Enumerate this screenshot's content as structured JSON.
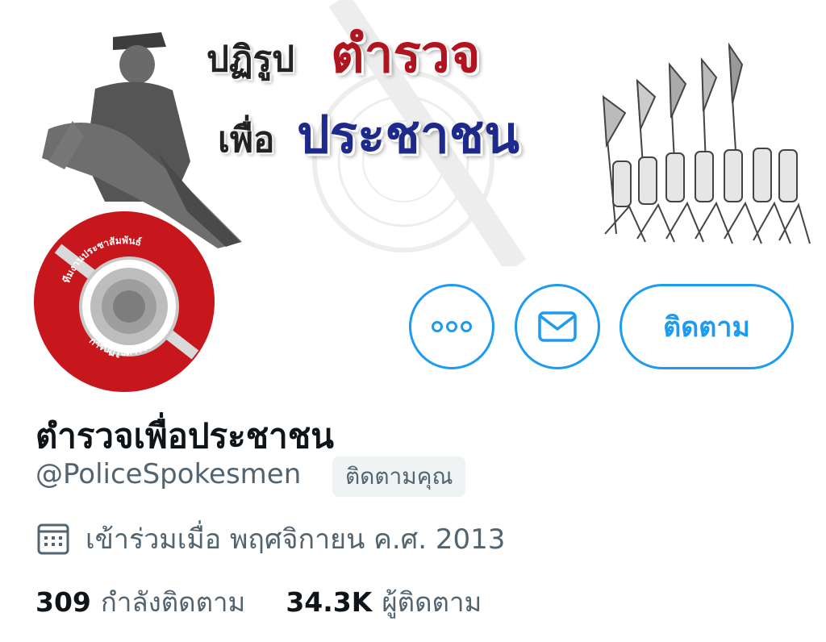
{
  "banner": {
    "line1_prefix": "ปฏิรูป",
    "line1_highlight": "ตำรวจ",
    "line2_prefix": "เพื่อ",
    "line2_highlight": "ประชาชน"
  },
  "avatar": {
    "ring_text_top": "ทีมงานประชาสัมพันธ์",
    "ring_text_bottom": "การปฏิรูปตำรวจ"
  },
  "actions": {
    "more_icon": "more-horizontal-icon",
    "message_icon": "envelope-icon",
    "follow_label": "ติดตาม"
  },
  "profile": {
    "display_name": "ตำรวจเพื่อประชาชน",
    "handle": "@PoliceSpokesmen",
    "follows_you_badge": "ติดตามคุณ",
    "joined_icon": "calendar-icon",
    "joined_text": "เข้าร่วมเมื่อ พฤศจิกายน ค.ศ. 2013"
  },
  "stats": {
    "following_count": "309",
    "following_label": "กำลังติดตาม",
    "followers_count": "34.3K",
    "followers_label": "ผู้ติดตาม"
  },
  "colors": {
    "accent": "#1d9bf0",
    "text_primary": "#0f1419",
    "text_secondary": "#536471",
    "badge_bg": "#eff3f4",
    "avatar_red": "#c8161d",
    "banner_red": "#b0141e",
    "banner_blue": "#1d2a8c"
  }
}
